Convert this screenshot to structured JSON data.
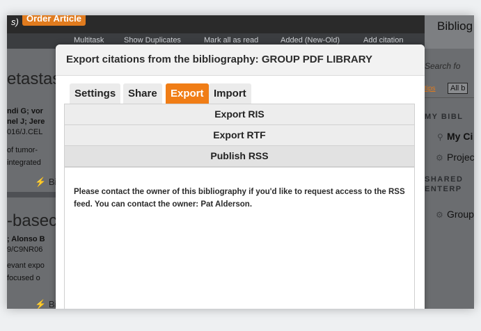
{
  "background": {
    "top_left_text": "s)",
    "order_button": "Order Article",
    "toolbar": [
      "Multitask",
      "Show Duplicates",
      "Mark all as read",
      "Added (New-Old)",
      "Add citation"
    ],
    "left_column": {
      "heading_1": "etastas",
      "authors_1a": "ndi G; vor",
      "authors_1b": "nel J; Jere",
      "doi_1": "016/J.CEL",
      "snippet_1a": "of tumor-",
      "snippet_1b": "integrated",
      "bib_1": "Bib",
      "heading_2": "-basec",
      "authors_2a": "; Alonso B",
      "doi_2": "9/C9NR06",
      "snippet_2a": "evant expo",
      "snippet_2b": "focused o",
      "bib_2": "Bib"
    },
    "right_column": {
      "title": "Bibliog",
      "search_placeholder": "Search fo",
      "tips": "tips",
      "all_button": "All b",
      "section_my": "MY BIBL",
      "my_item_1": "My Ci",
      "my_item_2": "Projec",
      "section_shared_1": "SHARED",
      "section_shared_2": "ENTERP",
      "shared_item_1": "Group"
    }
  },
  "modal": {
    "title": "Export citations from the bibliography:  GROUP PDF LIBRARY",
    "tabs": [
      {
        "label": "Settings",
        "active": false
      },
      {
        "label": "Share",
        "active": false
      },
      {
        "label": "Export",
        "active": true
      },
      {
        "label": "Import",
        "active": false
      }
    ],
    "accordion": [
      {
        "label": "Export RIS"
      },
      {
        "label": "Export RTF"
      },
      {
        "label": "Publish RSS"
      }
    ],
    "message": "Please contact the owner of this bibliography if you'd like to request access to the RSS feed. You can contact the owner: Pat Alderson."
  },
  "colors": {
    "accent": "#f07d16",
    "overlay": "#4a4d52",
    "modal_header": "#f2f2f2"
  }
}
